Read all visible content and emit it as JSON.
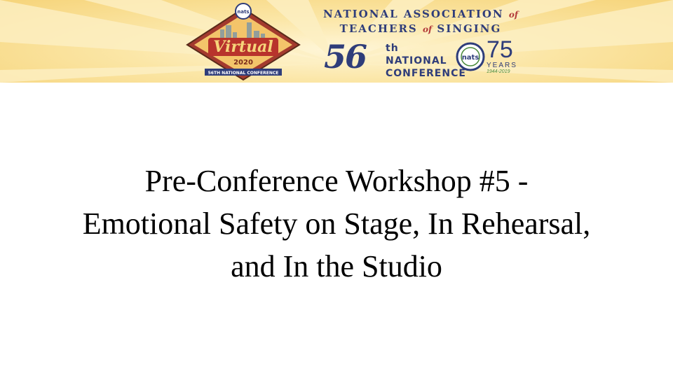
{
  "banner": {
    "badge": {
      "logo_text": "nats",
      "script_text": "Virtual",
      "year": "2020",
      "ribbon_text": "56TH NATIONAL CONFERENCE"
    },
    "org_line1": "NATIONAL ASSOCIATION",
    "org_of1": "of",
    "org_line2": "TEACHERS",
    "org_of2": "of",
    "org_line3": "SINGING",
    "conference_number": "56",
    "conference_suffix": "th NATIONAL",
    "conference_word": "CONFERENCE",
    "seal_text": "nats",
    "anniversary_number": "75",
    "anniversary_word": "YEARS",
    "anniversary_range": "1944-2019"
  },
  "slide": {
    "title_line1": "Pre-Conference Workshop #5 -",
    "title_line2": "Emotional Safety on Stage, In Rehearsal,",
    "title_line3": "and In the Studio"
  },
  "colors": {
    "banner_gold": "#f6d47a",
    "brand_blue": "#2f3d7a",
    "badge_red": "#b33a3a"
  }
}
